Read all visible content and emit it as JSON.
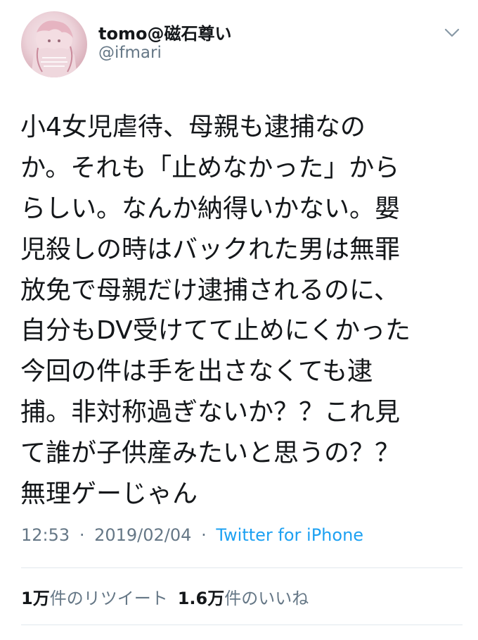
{
  "user": {
    "display_name": "tomo@磁石尊い",
    "handle": "@ifmari"
  },
  "tweet": {
    "lines": [
      "小4女児虐待、母親も逮捕なの",
      "か。それも「止めなかった」から",
      "らしい。なんか納得いかない。嬰",
      "児殺しの時はバックれた男は無罪",
      "放免で母親だけ逮捕されるのに、",
      "自分もDV受けてて止めにくかった",
      "今回の件は手を出さなくても逮",
      "捕。非対称過ぎないか？？これ見",
      "て誰が子供産みたいと思うの？？",
      "無理ゲーじゃん"
    ],
    "time": "12:53",
    "date": "2019/02/04",
    "separator": "·",
    "source": "Twitter for iPhone"
  },
  "stats": {
    "retweet_count": "1万",
    "retweet_label": "件のリツイート",
    "like_count": "1.6万",
    "like_label": "件のいいね"
  },
  "icons": {
    "menu": "chevron-down-icon"
  },
  "colors": {
    "text": "#14171a",
    "secondary": "#657786",
    "link": "#1da1f2",
    "divider": "#e1e8ed"
  }
}
